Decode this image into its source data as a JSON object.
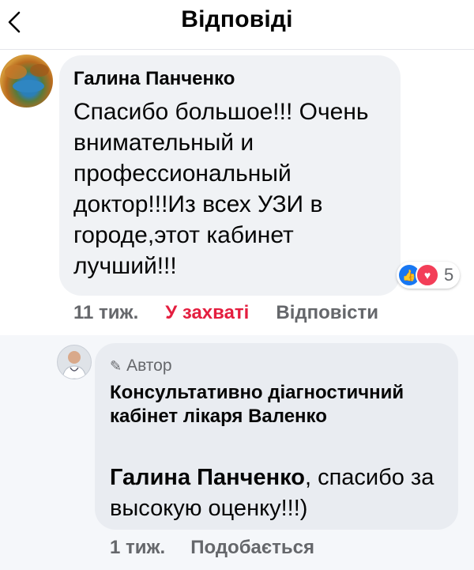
{
  "header": {
    "title": "Відповіді"
  },
  "comment": {
    "author": "Галина Панченко",
    "text": "Спасибо большое!!! Очень внимательный и профессиональный доктор!!!Из всех УЗИ в городе,этот кабинет лучший!!!",
    "reaction_count": "5",
    "time": "11 тиж.",
    "like_label": "У захваті",
    "reply_label": "Відповісти"
  },
  "reply": {
    "author_badge": "Автор",
    "author": "Консультативно діагностичний кабінет лікаря Валенко",
    "mention": "Галина Панченко",
    "text": ", спасибо за высокую оценку!!!)",
    "time": "1 тиж.",
    "like_label": "Подобається"
  },
  "colors": {
    "liked": "#e41e3f",
    "like_blue": "#1877f2",
    "love_red": "#f33e58"
  }
}
